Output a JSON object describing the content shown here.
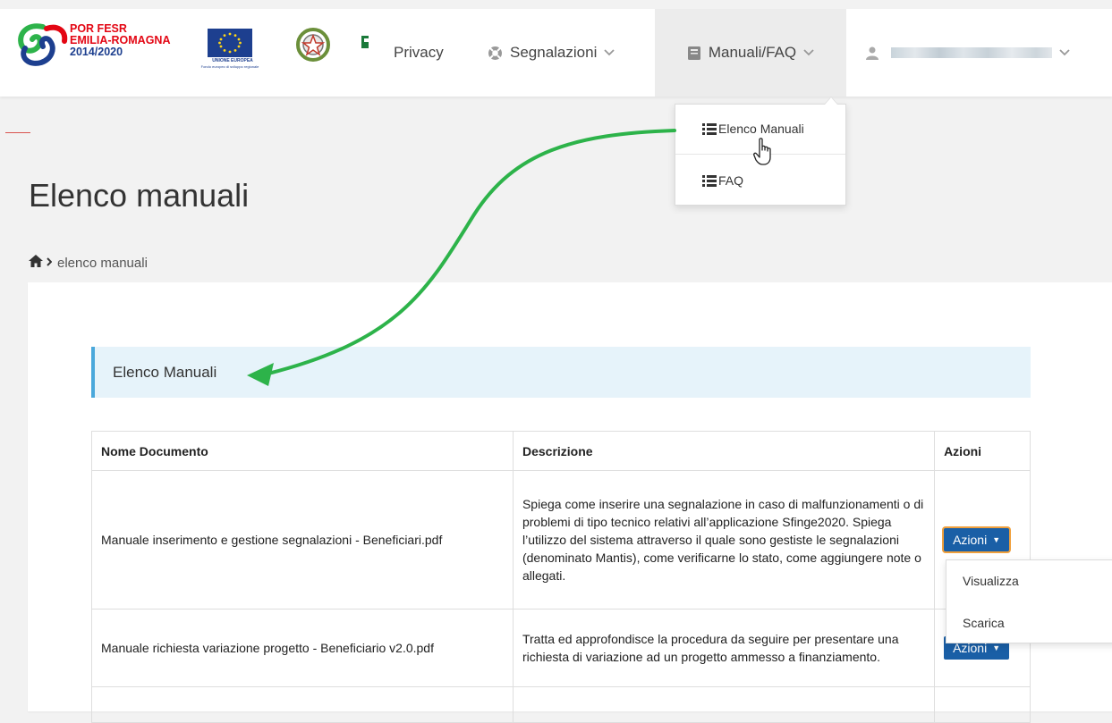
{
  "header": {
    "logo_porfesr": {
      "line1": "POR FESR",
      "line2": "EMILIA-ROMAGNA",
      "line3": "2014/2020"
    },
    "logo_ue": {
      "caption1": "UNIONE EUROPEA",
      "caption2": "Fondo europeo di sviluppo regionale"
    },
    "nav": {
      "privacy": "Privacy",
      "segnalazioni": "Segnalazioni",
      "manuali": "Manuali/FAQ"
    },
    "icons": {
      "segnalazioni": "lifebuoy-icon",
      "manuali": "book-icon",
      "user": "user-icon",
      "chevron": "chevron-down-icon"
    }
  },
  "dropdown": {
    "items": [
      {
        "label": "Elenco Manuali",
        "icon": "list-icon"
      },
      {
        "label": "FAQ",
        "icon": "list-icon"
      }
    ]
  },
  "page": {
    "title": "Elenco manuali",
    "breadcrumb": {
      "home_icon": "home-icon",
      "current": "elenco manuali"
    }
  },
  "panel": {
    "heading": "Elenco Manuali"
  },
  "table": {
    "headers": [
      "Nome Documento",
      "Descrizione",
      "Azioni"
    ],
    "rows": [
      {
        "name": "Manuale inserimento e gestione segnalazioni - Beneficiari.pdf",
        "description": "Spiega come inserire una segnalazione in caso di malfunzionamenti o di problemi di tipo tecnico relativi all’applicazione Sfinge2020. Spiega l’utilizzo del sistema attraverso il quale sono gestiste le segnalazioni (denominato Mantis), come verificarne lo stato, come aggiungere note o allegati.",
        "action": "Azioni"
      },
      {
        "name": "Manuale richiesta variazione progetto - Beneficiario v2.0.pdf",
        "description": "Tratta ed approfondisce la procedura da seguire per presentare una richiesta di variazione ad un progetto ammesso a finanziamento.",
        "action": "Azioni"
      }
    ]
  },
  "actions_menu": {
    "items": [
      "Visualizza",
      "Scarica"
    ]
  },
  "colors": {
    "accent_blue": "#1a5fa6",
    "info_border": "#4aa8db",
    "info_bg": "#e6f3fa",
    "annotation_arrow": "#2db34a",
    "focus_ring": "#f0a03c"
  }
}
